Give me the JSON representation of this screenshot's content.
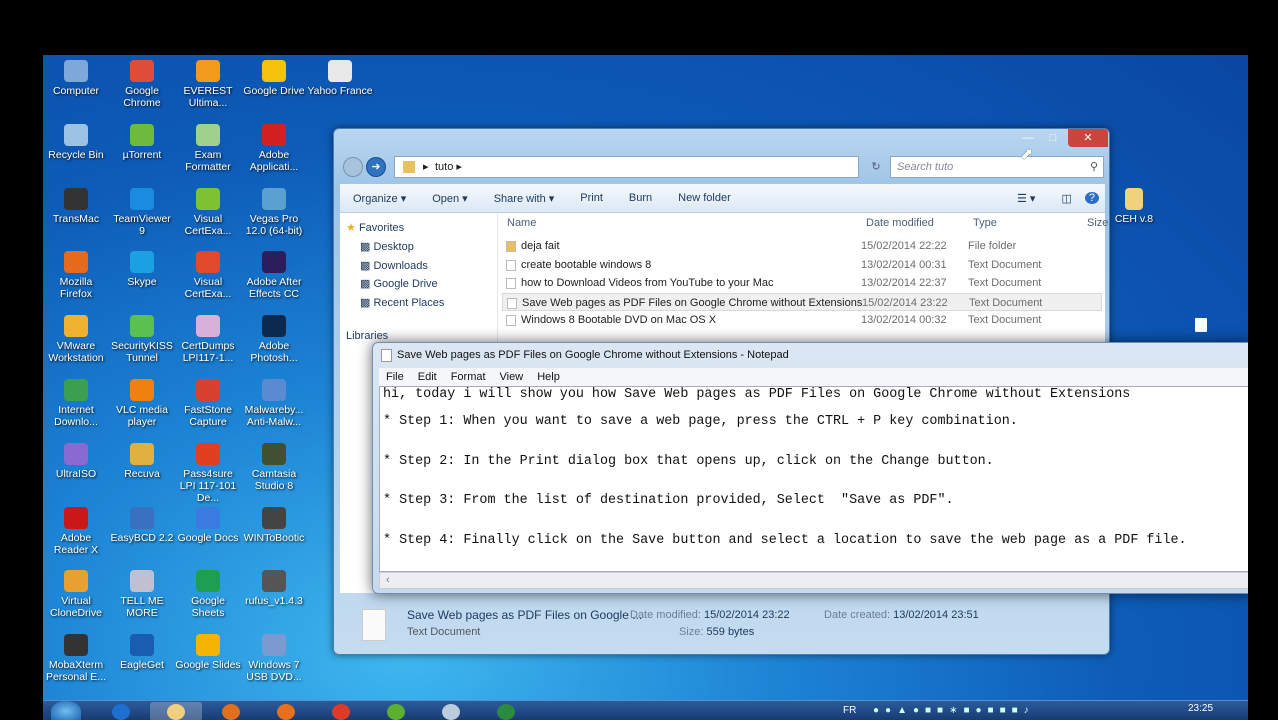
{
  "desktop_icons": [
    {
      "label": "Computer",
      "color": "#7ea8d8"
    },
    {
      "label": "Google Chrome",
      "color": "#e04c3a"
    },
    {
      "label": "EVEREST Ultima...",
      "color": "#f29a1c"
    },
    {
      "label": "Google Drive",
      "color": "#f4c20d"
    },
    {
      "label": "Yahoo France",
      "color": "#e8e8e8"
    },
    {
      "label": "Recycle Bin",
      "color": "#9cc3e6"
    },
    {
      "label": "µTorrent",
      "color": "#6cbb3c"
    },
    {
      "label": "Exam Formatter",
      "color": "#9fd08c"
    },
    {
      "label": "Adobe Applicati...",
      "color": "#d42020"
    },
    {
      "label": "TransMac",
      "color": "#333"
    },
    {
      "label": "TeamViewer 9",
      "color": "#1b8be0"
    },
    {
      "label": "Visual CertExa...",
      "color": "#7cc231"
    },
    {
      "label": "Vegas Pro 12.0 (64-bit)",
      "color": "#5aa0d0"
    },
    {
      "label": "Mozilla Firefox",
      "color": "#e66a1c"
    },
    {
      "label": "Skype",
      "color": "#1ba0e2"
    },
    {
      "label": "Visual CertExa...",
      "color": "#e04a2a"
    },
    {
      "label": "Adobe After Effects CC",
      "color": "#2a1e5c"
    },
    {
      "label": "VMware Workstation",
      "color": "#f0b030"
    },
    {
      "label": "SecurityKISS Tunnel",
      "color": "#5ac050"
    },
    {
      "label": "CertDumps LPI117-1...",
      "color": "#d8b0d8"
    },
    {
      "label": "Adobe Photosh...",
      "color": "#0c2a50"
    },
    {
      "label": "Internet Downlo...",
      "color": "#3aa050"
    },
    {
      "label": "VLC media player",
      "color": "#f08010"
    },
    {
      "label": "FastStone Capture",
      "color": "#d84030"
    },
    {
      "label": "Malwareby... Anti-Malw...",
      "color": "#5a8ad0"
    },
    {
      "label": "UltraISO",
      "color": "#8a6ad0"
    },
    {
      "label": "Recuva",
      "color": "#e0b040"
    },
    {
      "label": "Pass4sure LPI 117-101 De...",
      "color": "#e04020"
    },
    {
      "label": "Camtasia Studio 8",
      "color": "#405030"
    },
    {
      "label": "Adobe Reader X",
      "color": "#c81818"
    },
    {
      "label": "EasyBCD 2.2",
      "color": "#3a70c0"
    },
    {
      "label": "Google Docs",
      "color": "#3a7be0"
    },
    {
      "label": "WINToBootic",
      "color": "#444"
    },
    {
      "label": "Virtual CloneDrive",
      "color": "#e8a030"
    },
    {
      "label": "TELL ME MORE",
      "color": "#c0c0d0"
    },
    {
      "label": "Google Sheets",
      "color": "#1e9e50"
    },
    {
      "label": "rufus_v1.4.3",
      "color": "#555"
    },
    {
      "label": "MobaXterm Personal E...",
      "color": "#333"
    },
    {
      "label": "EagleGet",
      "color": "#1a5cb0"
    },
    {
      "label": "Google Slides",
      "color": "#f4b400"
    },
    {
      "label": "Windows 7 USB DVD...",
      "color": "#7a9ad0"
    }
  ],
  "right_icon": {
    "label": "CEH v.8"
  },
  "explorer": {
    "breadcrumb": "tuto",
    "search_placeholder": "Search tuto",
    "toolbar": [
      "Organize ▾",
      "Open ▾",
      "Share with ▾",
      "Print",
      "Burn",
      "New folder"
    ],
    "nav": {
      "favorites": "Favorites",
      "items": [
        "Desktop",
        "Downloads",
        "Google Drive",
        "Recent Places"
      ],
      "libraries": "Libraries"
    },
    "columns": [
      "Name",
      "Date modified",
      "Type",
      "Size"
    ],
    "files": [
      {
        "name": "deja fait",
        "date": "15/02/2014 22:22",
        "type": "File folder",
        "folder": true
      },
      {
        "name": "create bootable windows 8",
        "date": "13/02/2014 00:31",
        "type": "Text Document"
      },
      {
        "name": "how to Download Videos from YouTube to your Mac",
        "date": "13/02/2014 22:37",
        "type": "Text Document"
      },
      {
        "name": "Save Web pages as PDF Files on Google Chrome without Extensions",
        "date": "15/02/2014 23:22",
        "type": "Text Document",
        "selected": true
      },
      {
        "name": "Windows 8 Bootable DVD on Mac OS X",
        "date": "13/02/2014 00:32",
        "type": "Text Document"
      }
    ],
    "details": {
      "name": "Save Web pages as PDF Files on Google ...",
      "type": "Text Document",
      "modified_label": "Date modified:",
      "modified": "15/02/2014 23:22",
      "created_label": "Date created:",
      "created": "13/02/2014 23:51",
      "size_label": "Size:",
      "size": "559 bytes"
    }
  },
  "notepad": {
    "title": "Save Web pages as PDF Files on Google Chrome without Extensions - Notepad",
    "menu": [
      "File",
      "Edit",
      "Format",
      "View",
      "Help"
    ],
    "lines": [
      "hi, today i will show you how Save Web pages as PDF Files on Google Chrome without Extensions",
      "* Step 1: When you want to save a web page, press the CTRL + P key combination.",
      "* Step 2: In the Print dialog box that opens up, click on the Change button.",
      "* Step 3: From the list of destination provided, Select  \"Save as PDF\".",
      "* Step 4: Finally click on the Save button and select a location to save the web page as a PDF file."
    ]
  },
  "taskbar": {
    "language": "FR",
    "time": "23:25",
    "apps": [
      "start",
      "internet-explorer",
      "explorer",
      "media-player",
      "firefox",
      "chrome",
      "utorrent",
      "notepad",
      "camtasia"
    ]
  }
}
